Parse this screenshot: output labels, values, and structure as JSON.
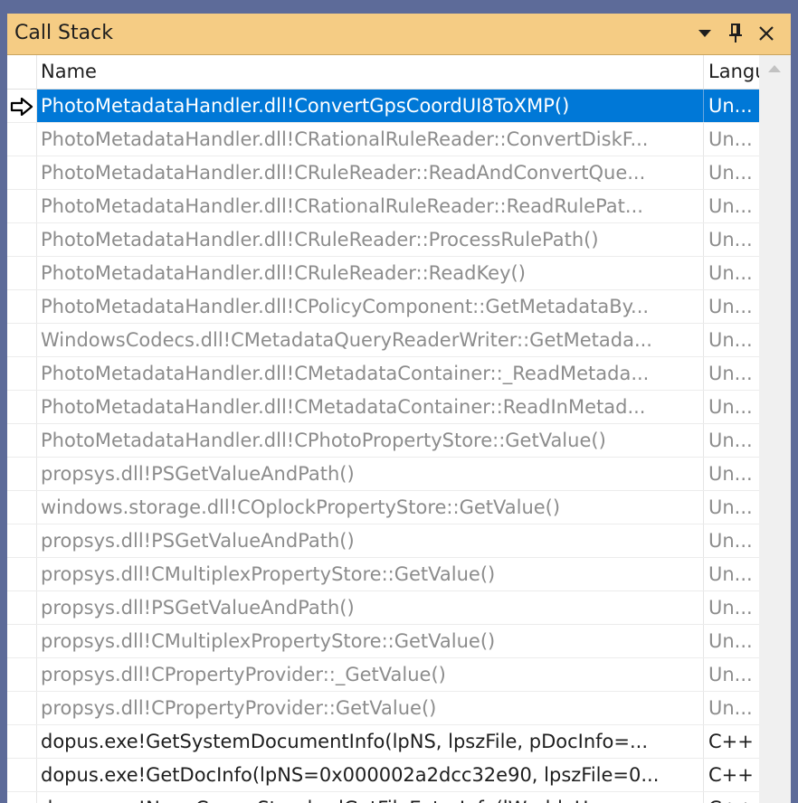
{
  "window": {
    "title": "Call Stack"
  },
  "columns": {
    "name": "Name",
    "language": "Langu"
  },
  "icons": {
    "dropdown": "chevron-down-icon",
    "pin": "pin-icon",
    "close": "close-icon",
    "current_frame": "current-frame-arrow-icon",
    "scroll_up": "scroll-up-icon"
  },
  "colors": {
    "titlebar": "#f5cc84",
    "selected": "#0078d7",
    "background": "#5d6b99"
  },
  "frames": [
    {
      "name": "PhotoMetadataHandler.dll!ConvertGpsCoordUI8ToXMP()",
      "lang": "Un...",
      "kind": "selected"
    },
    {
      "name": "PhotoMetadataHandler.dll!CRationalRuleReader::ConvertDiskF...",
      "lang": "Un...",
      "kind": "external"
    },
    {
      "name": "PhotoMetadataHandler.dll!CRuleReader::ReadAndConvertQue...",
      "lang": "Un...",
      "kind": "external"
    },
    {
      "name": "PhotoMetadataHandler.dll!CRationalRuleReader::ReadRulePat...",
      "lang": "Un...",
      "kind": "external"
    },
    {
      "name": "PhotoMetadataHandler.dll!CRuleReader::ProcessRulePath()",
      "lang": "Un...",
      "kind": "external"
    },
    {
      "name": "PhotoMetadataHandler.dll!CRuleReader::ReadKey()",
      "lang": "Un...",
      "kind": "external"
    },
    {
      "name": "PhotoMetadataHandler.dll!CPolicyComponent::GetMetadataBy...",
      "lang": "Un...",
      "kind": "external"
    },
    {
      "name": "WindowsCodecs.dll!CMetadataQueryReaderWriter::GetMetada...",
      "lang": "Un...",
      "kind": "external"
    },
    {
      "name": "PhotoMetadataHandler.dll!CMetadataContainer::_ReadMetada...",
      "lang": "Un...",
      "kind": "external"
    },
    {
      "name": "PhotoMetadataHandler.dll!CMetadataContainer::ReadInMetad...",
      "lang": "Un...",
      "kind": "external"
    },
    {
      "name": "PhotoMetadataHandler.dll!CPhotoPropertyStore::GetValue()",
      "lang": "Un...",
      "kind": "external"
    },
    {
      "name": "propsys.dll!PSGetValueAndPath()",
      "lang": "Un...",
      "kind": "external"
    },
    {
      "name": "windows.storage.dll!COplockPropertyStore::GetValue()",
      "lang": "Un...",
      "kind": "external"
    },
    {
      "name": "propsys.dll!PSGetValueAndPath()",
      "lang": "Un...",
      "kind": "external"
    },
    {
      "name": "propsys.dll!CMultiplexPropertyStore::GetValue()",
      "lang": "Un...",
      "kind": "external"
    },
    {
      "name": "propsys.dll!PSGetValueAndPath()",
      "lang": "Un...",
      "kind": "external"
    },
    {
      "name": "propsys.dll!CMultiplexPropertyStore::GetValue()",
      "lang": "Un...",
      "kind": "external"
    },
    {
      "name": "propsys.dll!CPropertyProvider::_GetValue()",
      "lang": "Un...",
      "kind": "external"
    },
    {
      "name": "propsys.dll!CPropertyProvider::GetValue()",
      "lang": "Un...",
      "kind": "external"
    },
    {
      "name": "dopus.exe!GetSystemDocumentInfo(lpNS, lpszFile, pDocInfo=...",
      "lang": "C++",
      "kind": "user"
    },
    {
      "name": "dopus.exe!GetDocInfo(lpNS=0x000002a2dcc32e90, lpszFile=0...",
      "lang": "C++",
      "kind": "user"
    },
    {
      "name": "dopus.exe!NeonCommStandardGetFileExtraInfo(lWorldeH...",
      "lang": "C++",
      "kind": "user"
    }
  ]
}
